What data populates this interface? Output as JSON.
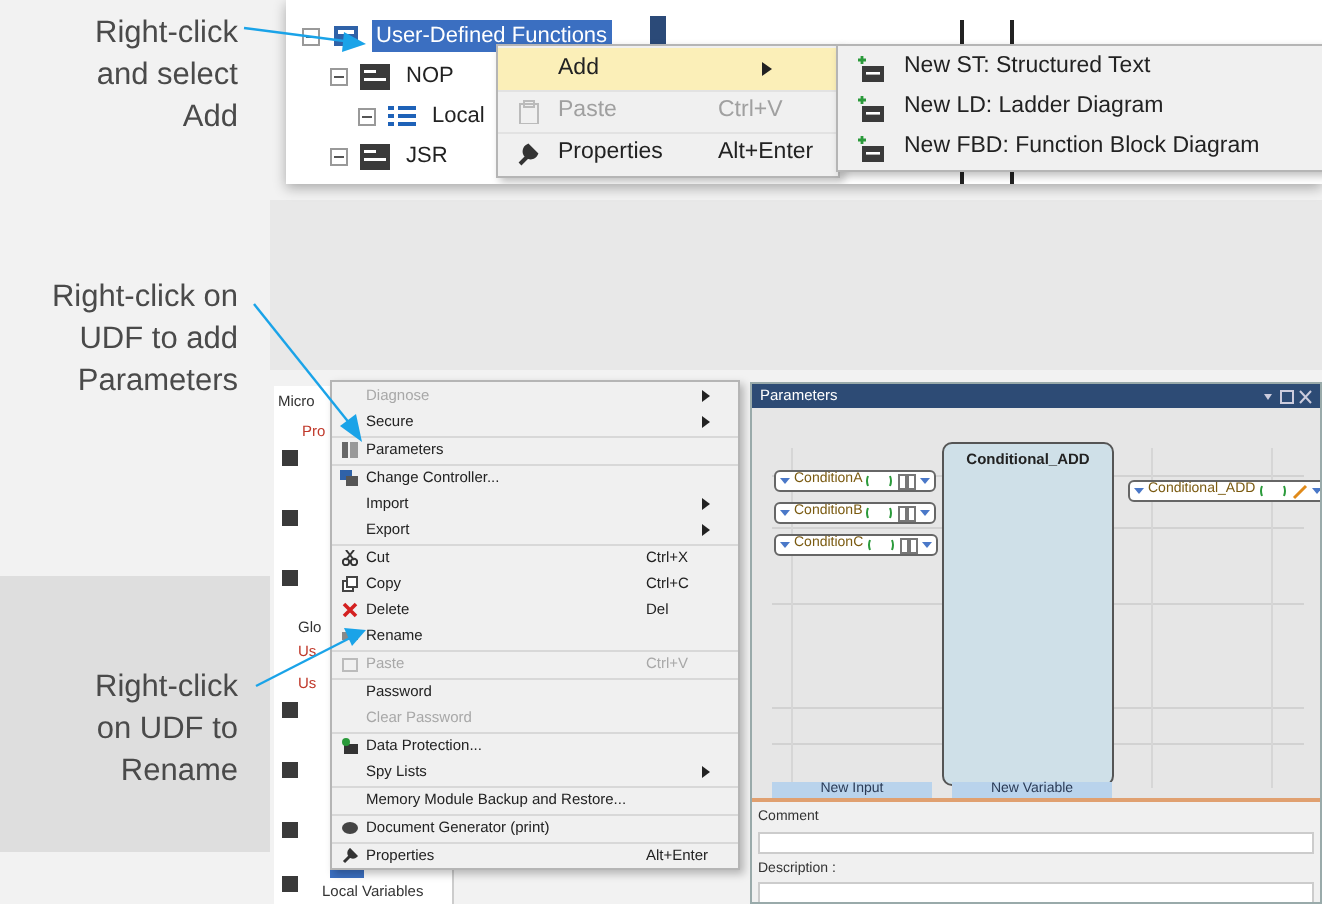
{
  "callouts": [
    {
      "lines": [
        "Right-click",
        "and select",
        "Add"
      ]
    },
    {
      "lines": [
        "Right-click on",
        "UDF to add",
        "Parameters"
      ]
    },
    {
      "lines": [
        "Right-click",
        "on UDF to",
        "Rename"
      ]
    }
  ],
  "top_screenshot": {
    "tree": [
      {
        "label": "User-Defined Functions",
        "selected": true,
        "children": [
          {
            "label": "NOP",
            "selected": false,
            "children": [
              {
                "label": "Local",
                "selected": false
              }
            ]
          },
          {
            "label": "JSR",
            "selected": false
          }
        ]
      }
    ],
    "context_menu": [
      {
        "label": "Add",
        "selected": true,
        "disabled": false,
        "has_submenu": true
      },
      {
        "label": "Paste",
        "shortcut": "Ctrl+V",
        "selected": false,
        "disabled": true,
        "has_submenu": false
      },
      {
        "label": "Properties",
        "shortcut": "Alt+Enter",
        "selected": false,
        "disabled": false,
        "has_submenu": false
      }
    ],
    "submenu": [
      "New ST: Structured Text",
      "New LD: Ladder Diagram",
      "New FBD: Function Block Diagram"
    ]
  },
  "bottom_screenshot": {
    "tree": [
      {
        "label": "Micro",
        "color": "#333333"
      },
      {
        "label": "Pro",
        "color": "#c0392b"
      },
      {
        "label": "Glo",
        "color": "#333333"
      },
      {
        "label": "Us",
        "color": "#c0392b"
      },
      {
        "label": "Us",
        "color": "#c0392b"
      },
      {
        "label": "Local Variables",
        "color": "#333333"
      }
    ],
    "context_menu": [
      {
        "label": "Diagnose",
        "disabled": true,
        "has_submenu": true,
        "separator_before": false
      },
      {
        "label": "Secure",
        "disabled": false,
        "has_submenu": true,
        "separator_before": false
      },
      {
        "label": "Parameters",
        "disabled": false,
        "has_submenu": false,
        "separator_before": true
      },
      {
        "label": "Change Controller...",
        "disabled": false,
        "has_submenu": false,
        "separator_before": true
      },
      {
        "label": "Import",
        "disabled": false,
        "has_submenu": true,
        "separator_before": false
      },
      {
        "label": "Export",
        "disabled": false,
        "has_submenu": true,
        "separator_before": false
      },
      {
        "label": "Cut",
        "shortcut": "Ctrl+X",
        "disabled": false,
        "has_submenu": false,
        "separator_before": true
      },
      {
        "label": "Copy",
        "shortcut": "Ctrl+C",
        "disabled": false,
        "has_submenu": false,
        "separator_before": false
      },
      {
        "label": "Delete",
        "shortcut": "Del",
        "disabled": false,
        "has_submenu": false,
        "separator_before": false
      },
      {
        "label": "Rename",
        "disabled": false,
        "has_submenu": false,
        "separator_before": false
      },
      {
        "label": "Paste",
        "shortcut": "Ctrl+V",
        "disabled": true,
        "has_submenu": false,
        "separator_before": true
      },
      {
        "label": "Password",
        "disabled": false,
        "has_submenu": false,
        "separator_before": true
      },
      {
        "label": "Clear Password",
        "disabled": true,
        "has_submenu": false,
        "separator_before": false
      },
      {
        "label": "Data Protection...",
        "disabled": false,
        "has_submenu": false,
        "separator_before": true
      },
      {
        "label": "Spy Lists",
        "disabled": false,
        "has_submenu": true,
        "separator_before": false
      },
      {
        "label": "Memory Module Backup and Restore...",
        "disabled": false,
        "has_submenu": false,
        "separator_before": true
      },
      {
        "label": "Document Generator (print)",
        "disabled": false,
        "has_submenu": false,
        "separator_before": true
      },
      {
        "label": "Properties",
        "shortcut": "Alt+Enter",
        "disabled": false,
        "has_submenu": false,
        "separator_before": true
      }
    ],
    "parameters_window": {
      "title": "Parameters",
      "block_title": "Conditional_ADD",
      "inputs": [
        "ConditionA",
        "ConditionB",
        "ConditionC"
      ],
      "outputs": [
        "Conditional_ADD"
      ],
      "buttons": [
        "New Input",
        "New Variable"
      ],
      "comment_label": "Comment",
      "description_label": "Description :"
    }
  }
}
